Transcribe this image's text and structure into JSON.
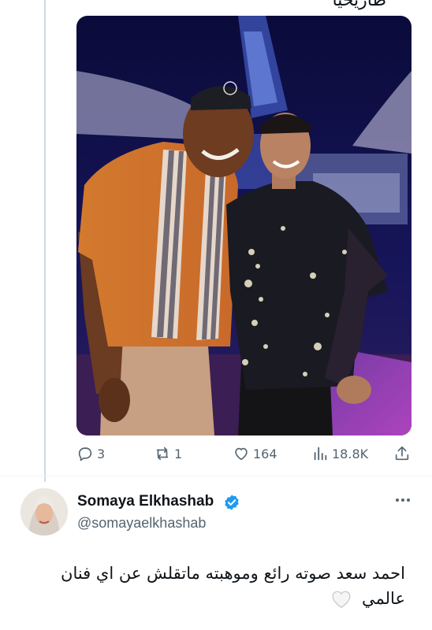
{
  "previous_tweet": {
    "cut_text": "طاريحيا",
    "actions": {
      "replies": "3",
      "retweets": "1",
      "likes": "164",
      "views": "18.8K"
    }
  },
  "tweet": {
    "author_name": "Somaya Elkhashab",
    "author_handle": "@somayaelkhashab",
    "verified": true,
    "text": "احمد سعد صوته رائع وموهبته ماتقلش عن اي فنان عالمي",
    "emoji": "white-heart"
  },
  "icons": {
    "reply": "reply-icon",
    "retweet": "retweet-icon",
    "like": "heart-icon",
    "views": "views-icon",
    "share": "share-icon",
    "verified": "verified-badge-icon",
    "more": "more-icon"
  },
  "colors": {
    "secondary_text": "#536471",
    "verified_blue": "#1d9bf0",
    "divider": "#eff3f4"
  }
}
